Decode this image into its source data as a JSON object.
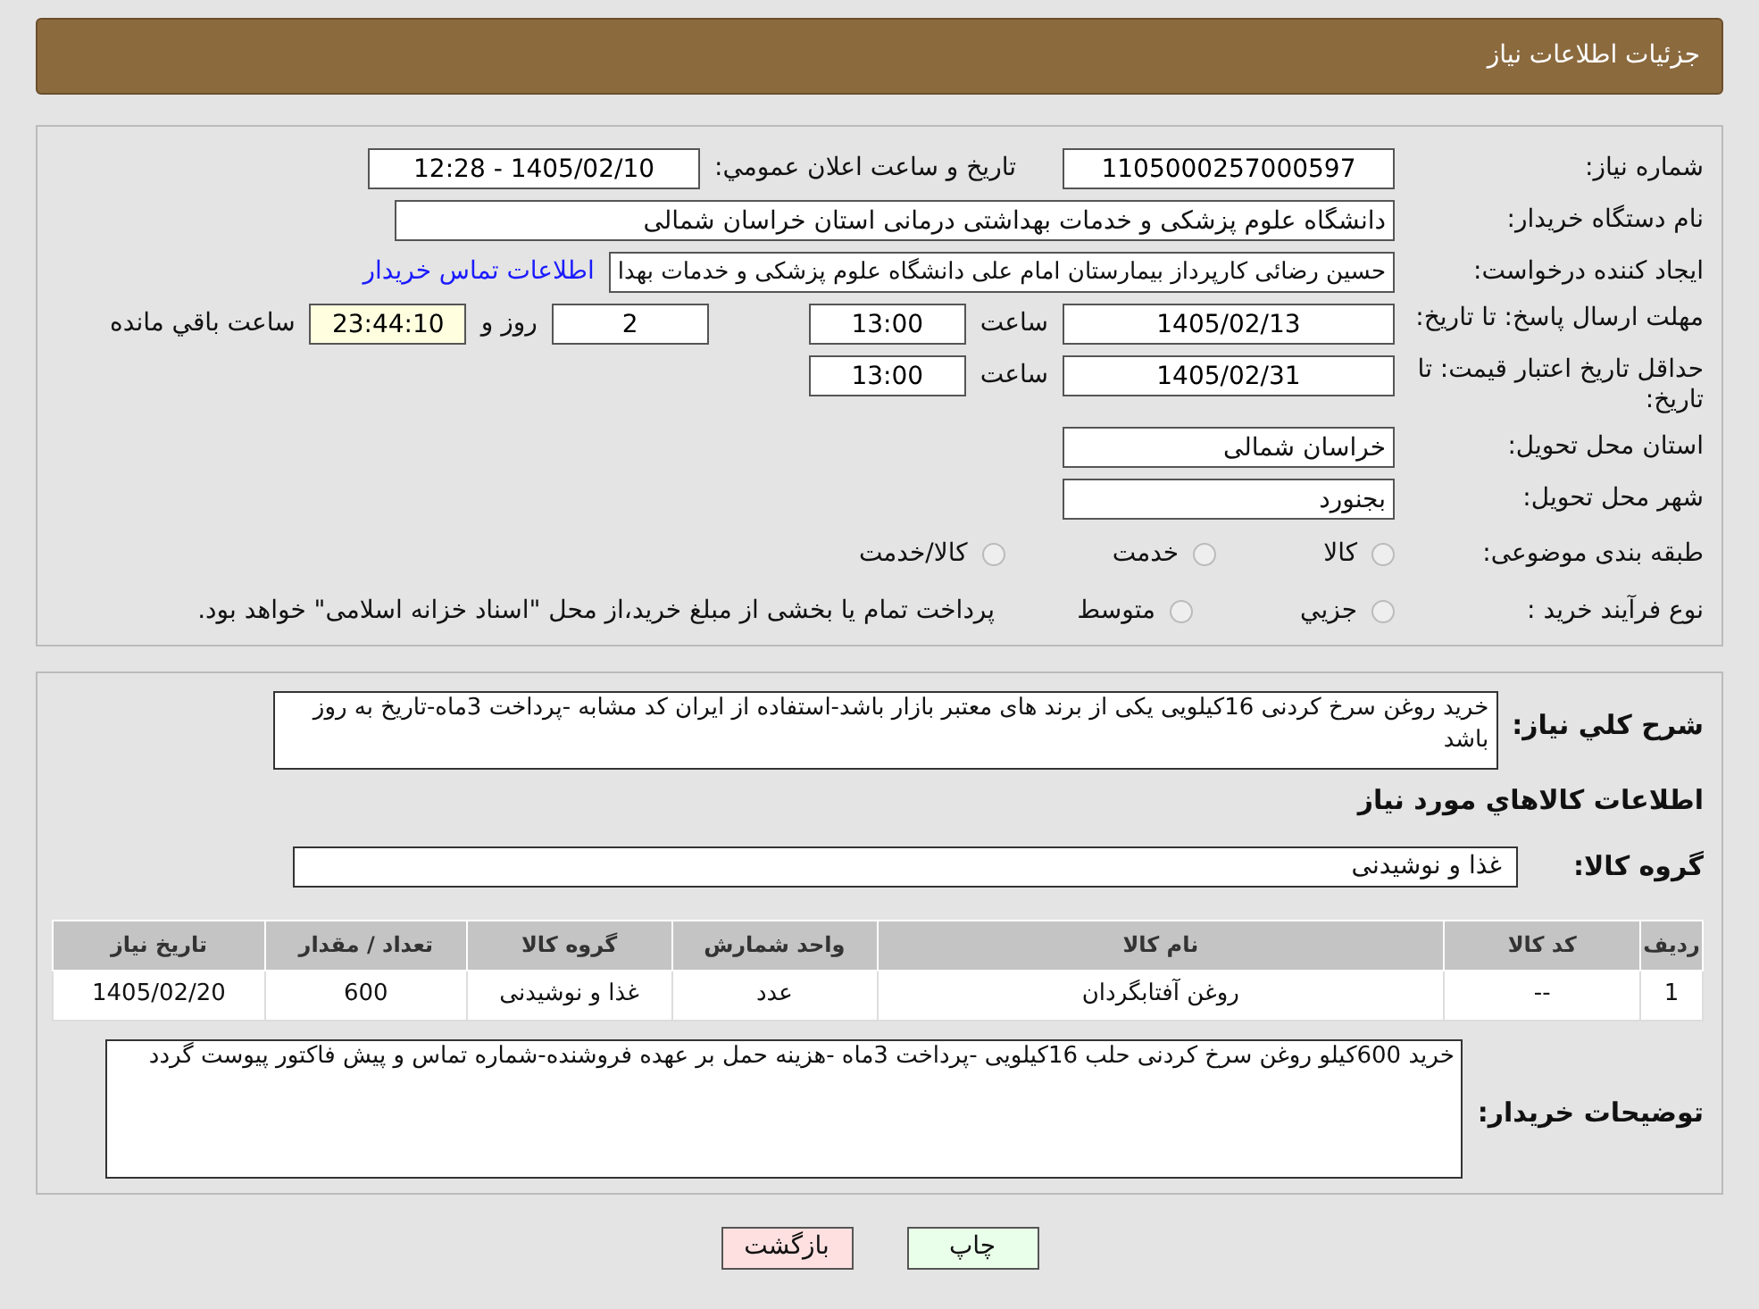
{
  "header": {
    "title": "جزئیات اطلاعات نیاز"
  },
  "details": {
    "need_number": {
      "label": "شماره نیاز:",
      "value": "1105000257000597"
    },
    "announce_datetime": {
      "label": "تاریخ و ساعت اعلان عمومي:",
      "value": "1405/02/10 - 12:28"
    },
    "buyer_org": {
      "label": "نام دستگاه خریدار:",
      "value": "دانشگاه علوم پزشکی و خدمات بهداشتی درمانی استان خراسان شمالی"
    },
    "requester": {
      "label": "ایجاد کننده درخواست:",
      "value": "حسین رضائی کارپرداز بیمارستان امام علی دانشگاه علوم پزشکی و خدمات بهدا",
      "link": "اطلاعات تماس خریدار"
    },
    "reply_deadline": {
      "label": "مهلت ارسال پاسخ: تا تاریخ:",
      "date": "1405/02/13",
      "time_label": "ساعت",
      "time": "13:00",
      "days": "2",
      "days_label": "روز و",
      "remaining": "23:44:10",
      "remaining_label": "ساعت باقي مانده"
    },
    "price_validity": {
      "label": "حداقل تاریخ اعتبار قیمت: تا تاریخ:",
      "date": "1405/02/31",
      "time_label": "ساعت",
      "time": "13:00"
    },
    "province": {
      "label": "استان محل تحویل:",
      "value": "خراسان شمالی"
    },
    "city": {
      "label": "شهر محل تحویل:",
      "value": "بجنورد"
    },
    "category": {
      "label": "طبقه بندی موضوعی:",
      "options": [
        {
          "label": "کالا",
          "selected": false
        },
        {
          "label": "خدمت",
          "selected": false
        },
        {
          "label": "کالا/خدمت",
          "selected": false
        }
      ]
    },
    "process": {
      "label": "نوع فرآیند خرید :",
      "options": [
        {
          "label": "جزيي",
          "selected": false
        },
        {
          "label": "متوسط",
          "selected": false
        }
      ],
      "note": "پرداخت تمام یا بخشی از مبلغ خرید،از محل \"اسناد خزانه اسلامی\" خواهد بود."
    }
  },
  "summary": {
    "label": "شرح کلي نیاز:",
    "value": "خرید روغن سرخ کردنی 16کیلویی یکی از برند های معتبر بازار باشد-استفاده از ایران کد مشابه -پرداخت 3ماه-تاریخ به روز باشد"
  },
  "goods_heading": "اطلاعات کالاهاي مورد نیاز",
  "goods_group": {
    "label": "گروه کالا:",
    "value": "غذا و نوشیدنی"
  },
  "table": {
    "columns": [
      "ردیف",
      "کد کالا",
      "نام کالا",
      "واحد شمارش",
      "گروه کالا",
      "تعداد / مقدار",
      "تاریخ نیاز"
    ],
    "rows": [
      [
        "1",
        "--",
        "روغن آفتابگردان",
        "عدد",
        "غذا و نوشیدنی",
        "600",
        "1405/02/20"
      ]
    ]
  },
  "buyer_notes": {
    "label": "توضیحات خریدار:",
    "value": "خرید 600کیلو روغن سرخ کردنی حلب 16کیلویی -پرداخت 3ماه -هزینه حمل بر عهده فروشنده-شماره تماس و پیش فاکتور پیوست گردد"
  },
  "buttons": [
    {
      "label": "چاپ",
      "kind": "print"
    },
    {
      "label": "بازگشت",
      "kind": "back"
    }
  ]
}
